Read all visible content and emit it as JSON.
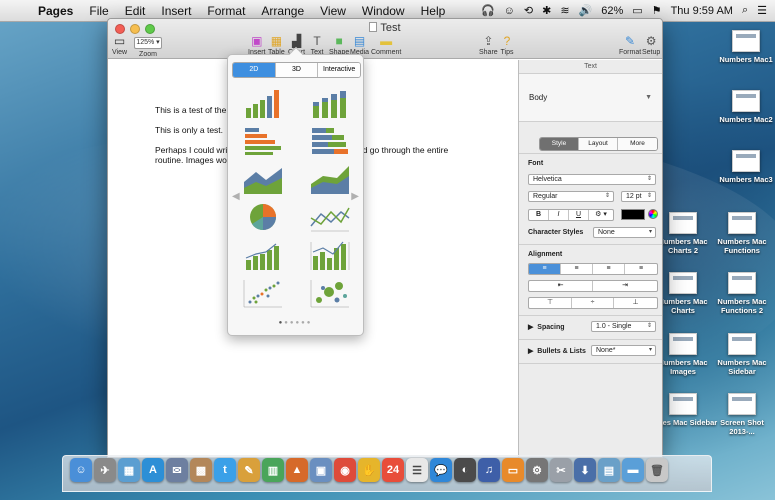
{
  "menubar": {
    "app": "Pages",
    "items": [
      "File",
      "Edit",
      "Insert",
      "Format",
      "Arrange",
      "View",
      "Window",
      "Help"
    ],
    "battery": "62%",
    "clock": "Thu 9:59 AM"
  },
  "window": {
    "title": "Test",
    "toolbar": {
      "view": "View",
      "zoom_value": "125%",
      "zoom": "Zoom",
      "insert": "Insert",
      "table": "Table",
      "chart": "Chart",
      "text": "Text",
      "shape": "Shape",
      "media": "Media",
      "comment": "Comment",
      "share": "Share",
      "tips": "Tips",
      "format": "Format",
      "setup": "Setup"
    }
  },
  "document": {
    "p1": "This is a test of the e",
    "p2": "This is only a test.",
    "p3a": "Perhaps I could writ",
    "p3b": "f I could go through the entire",
    "p3c": "routine. Images wou"
  },
  "sidebar": {
    "header": "Text",
    "paragraph_style": "Body",
    "tabs": [
      "Style",
      "Layout",
      "More"
    ],
    "font_label": "Font",
    "font_family": "Helvetica",
    "font_weight": "Regular",
    "font_size": "12 pt",
    "format_buttons": [
      "B",
      "I",
      "U",
      "⚙ ▾"
    ],
    "char_styles_label": "Character Styles",
    "char_styles_value": "None",
    "alignment_label": "Alignment",
    "spacing_label": "Spacing",
    "spacing_value": "1.0 - Single",
    "bullets_label": "Bullets & Lists",
    "bullets_value": "None*"
  },
  "chart_popover": {
    "tabs": [
      "2D",
      "3D",
      "Interactive"
    ],
    "active_tab": "2D",
    "chart_types": [
      "column",
      "stacked-column",
      "bar",
      "stacked-bar",
      "area",
      "stacked-area",
      "pie",
      "line",
      "column-line",
      "stacked-column-line",
      "scatter",
      "bubble"
    ]
  },
  "desktop_icons": [
    {
      "label": "Numbers Mac1"
    },
    {
      "label": "Numbers Mac2"
    },
    {
      "label": "Numbers Mac3"
    },
    {
      "label": "Numbers Mac Charts 2"
    },
    {
      "label": "Numbers Mac Functions"
    },
    {
      "label": "Numbers Mac Charts"
    },
    {
      "label": "Numbers Mac Functions 2"
    },
    {
      "label": "Numbers Mac Images"
    },
    {
      "label": "Numbers Mac Sidebar"
    },
    {
      "label": "Pages Mac Sidebar"
    },
    {
      "label": "Screen Shot 2013-..."
    }
  ],
  "colors": {
    "orange": "#e8722a",
    "green": "#6ea33a",
    "blue_gray": "#5b7ea6",
    "teal": "#5da59b",
    "accent": "#3e8fe0"
  }
}
